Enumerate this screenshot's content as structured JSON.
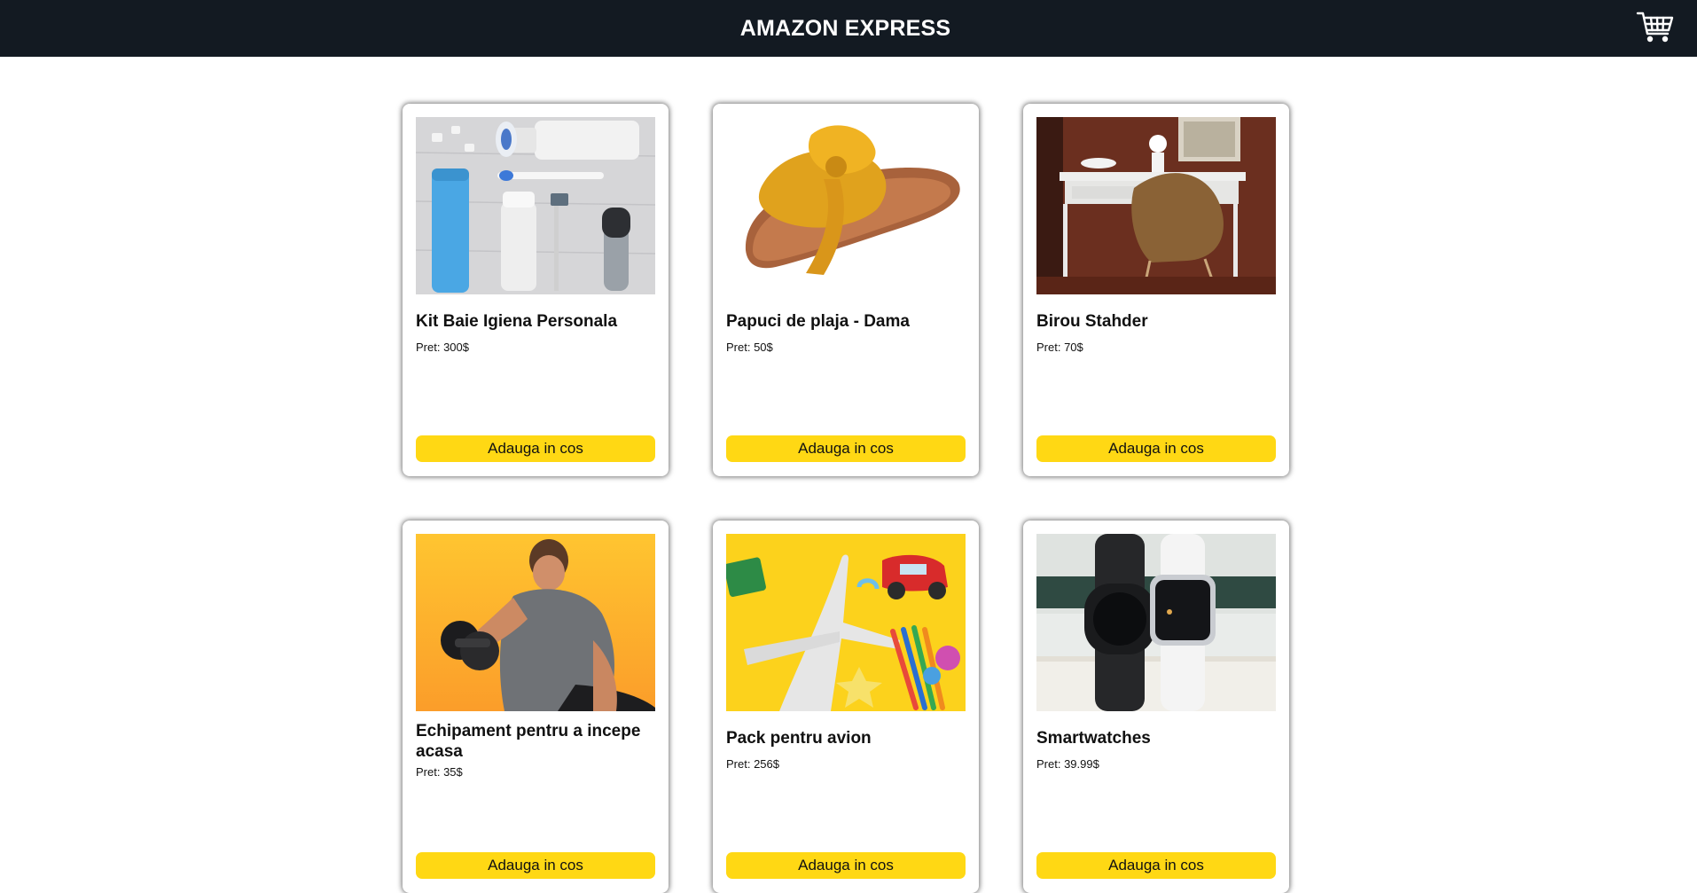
{
  "header": {
    "brand": "AMAZON EXPRESS",
    "cart_icon": "shopping-cart-icon",
    "background": "#131a22"
  },
  "products": [
    {
      "title": "Kit Baie Igiena Personala",
      "price": "Pret: 300$",
      "button_label": "Adauga in cos"
    },
    {
      "title": "Papuci de plaja - Dama",
      "price": "Pret: 50$",
      "button_label": "Adauga in cos"
    },
    {
      "title": "Birou Stahder",
      "price": "Pret: 70$",
      "button_label": "Adauga in cos"
    },
    {
      "title": "Echipament pentru a incepe acasa",
      "price": "Pret: 35$",
      "button_label": "Adauga in cos"
    },
    {
      "title": "Pack pentru avion",
      "price": "Pret: 256$",
      "button_label": "Adauga in cos"
    },
    {
      "title": "Smartwatches",
      "price": "Pret: 39.99$",
      "button_label": "Adauga in cos"
    }
  ],
  "colors": {
    "button": "#ffd814",
    "card_bg": "#ffffff"
  }
}
